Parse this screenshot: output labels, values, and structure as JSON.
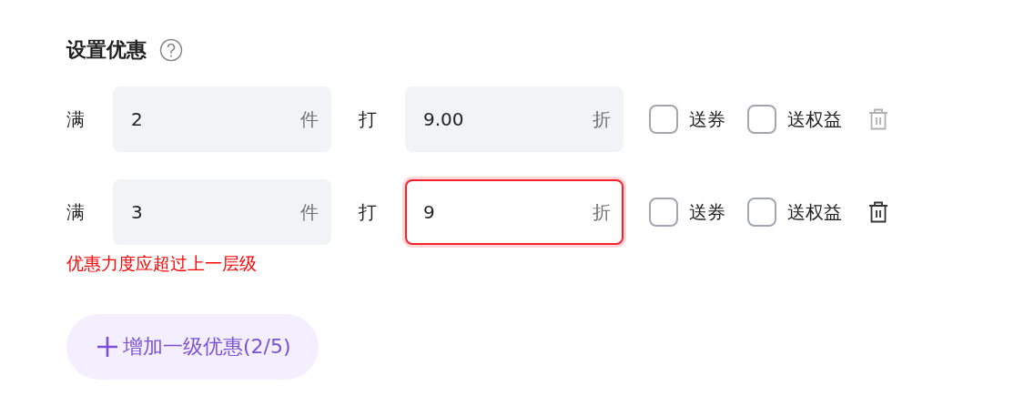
{
  "section": {
    "title": "设置优惠"
  },
  "tiers": [
    {
      "prefix": "满",
      "count": {
        "value": "2",
        "unit": "件"
      },
      "mid": "打",
      "discount": {
        "value": "9.00",
        "unit": "折",
        "error": false
      },
      "options": [
        {
          "label": "送券",
          "checked": false
        },
        {
          "label": "送权益",
          "checked": false
        }
      ],
      "delete_disabled": true
    },
    {
      "prefix": "满",
      "count": {
        "value": "3",
        "unit": "件"
      },
      "mid": "打",
      "discount": {
        "value": "9",
        "unit": "折",
        "error": true
      },
      "options": [
        {
          "label": "送券",
          "checked": false
        },
        {
          "label": "送权益",
          "checked": false
        }
      ],
      "delete_disabled": false,
      "error_message": "优惠力度应超过上一层级"
    }
  ],
  "add_button": {
    "label": "增加一级优惠(2/5)"
  }
}
